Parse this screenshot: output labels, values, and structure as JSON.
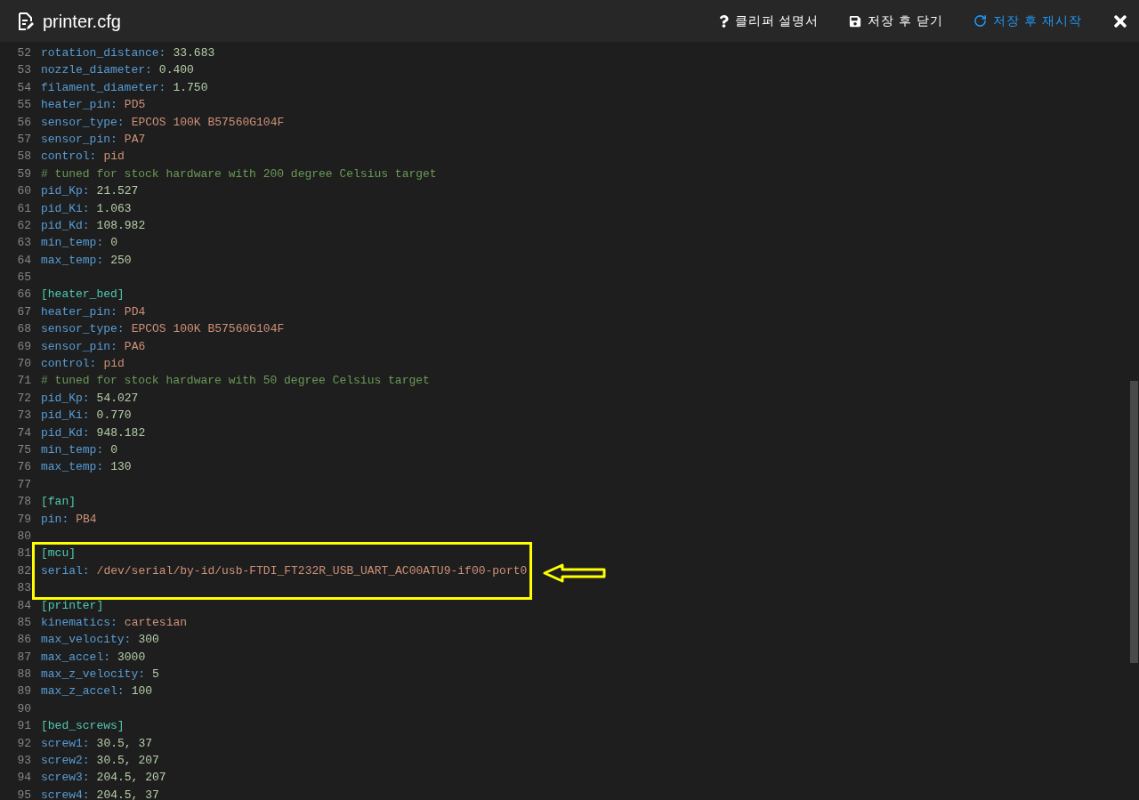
{
  "window": {
    "title": "printer.cfg"
  },
  "toolbar": [
    {
      "kind": "help",
      "label": "클리퍼 설명서"
    },
    {
      "kind": "save",
      "label": "저장 후 닫기"
    },
    {
      "kind": "restart",
      "label": "저장 후 재시작"
    }
  ],
  "lines": [
    {
      "number": "52",
      "kind": "pair",
      "key": "rotation_distance:",
      "value": {
        "text": "33.683",
        "kind": "number"
      },
      "highlighted": false
    },
    {
      "number": "53",
      "kind": "pair",
      "key": "nozzle_diameter:",
      "value": {
        "text": "0.400",
        "kind": "number"
      },
      "highlighted": false
    },
    {
      "number": "54",
      "kind": "pair",
      "key": "filament_diameter:",
      "value": {
        "text": "1.750",
        "kind": "number"
      },
      "highlighted": false
    },
    {
      "number": "55",
      "kind": "pair",
      "key": "heater_pin:",
      "value": {
        "text": "PD5",
        "kind": "string"
      },
      "highlighted": false
    },
    {
      "number": "56",
      "kind": "pair",
      "key": "sensor_type:",
      "value": {
        "text": "EPCOS 100K B57560G104F",
        "kind": "string"
      },
      "highlighted": false
    },
    {
      "number": "57",
      "kind": "pair",
      "key": "sensor_pin:",
      "value": {
        "text": "PA7",
        "kind": "string"
      },
      "highlighted": false
    },
    {
      "number": "58",
      "kind": "pair",
      "key": "control:",
      "value": {
        "text": "pid",
        "kind": "string"
      },
      "highlighted": false
    },
    {
      "number": "59",
      "kind": "comment",
      "text": "# tuned for stock hardware with 200 degree Celsius target",
      "highlighted": false
    },
    {
      "number": "60",
      "kind": "pair",
      "key": "pid_Kp:",
      "value": {
        "text": "21.527",
        "kind": "number"
      },
      "highlighted": false
    },
    {
      "number": "61",
      "kind": "pair",
      "key": "pid_Ki:",
      "value": {
        "text": "1.063",
        "kind": "number"
      },
      "highlighted": false
    },
    {
      "number": "62",
      "kind": "pair",
      "key": "pid_Kd:",
      "value": {
        "text": "108.982",
        "kind": "number"
      },
      "highlighted": false
    },
    {
      "number": "63",
      "kind": "pair",
      "key": "min_temp:",
      "value": {
        "text": "0",
        "kind": "number"
      },
      "highlighted": false
    },
    {
      "number": "64",
      "kind": "pair",
      "key": "max_temp:",
      "value": {
        "text": "250",
        "kind": "number"
      },
      "highlighted": false
    },
    {
      "number": "65",
      "kind": "blank",
      "highlighted": false
    },
    {
      "number": "66",
      "kind": "section",
      "text": "[heater_bed]",
      "highlighted": false
    },
    {
      "number": "67",
      "kind": "pair",
      "key": "heater_pin:",
      "value": {
        "text": "PD4",
        "kind": "string"
      },
      "highlighted": false
    },
    {
      "number": "68",
      "kind": "pair",
      "key": "sensor_type:",
      "value": {
        "text": "EPCOS 100K B57560G104F",
        "kind": "string"
      },
      "highlighted": false
    },
    {
      "number": "69",
      "kind": "pair",
      "key": "sensor_pin:",
      "value": {
        "text": "PA6",
        "kind": "string"
      },
      "highlighted": false
    },
    {
      "number": "70",
      "kind": "pair",
      "key": "control:",
      "value": {
        "text": "pid",
        "kind": "string"
      },
      "highlighted": false
    },
    {
      "number": "71",
      "kind": "comment",
      "text": "# tuned for stock hardware with 50 degree Celsius target",
      "highlighted": false
    },
    {
      "number": "72",
      "kind": "pair",
      "key": "pid_Kp:",
      "value": {
        "text": "54.027",
        "kind": "number"
      },
      "highlighted": false
    },
    {
      "number": "73",
      "kind": "pair",
      "key": "pid_Ki:",
      "value": {
        "text": "0.770",
        "kind": "number"
      },
      "highlighted": false
    },
    {
      "number": "74",
      "kind": "pair",
      "key": "pid_Kd:",
      "value": {
        "text": "948.182",
        "kind": "number"
      },
      "highlighted": false
    },
    {
      "number": "75",
      "kind": "pair",
      "key": "min_temp:",
      "value": {
        "text": "0",
        "kind": "number"
      },
      "highlighted": false
    },
    {
      "number": "76",
      "kind": "pair",
      "key": "max_temp:",
      "value": {
        "text": "130",
        "kind": "number"
      },
      "highlighted": false
    },
    {
      "number": "77",
      "kind": "blank",
      "highlighted": false
    },
    {
      "number": "78",
      "kind": "section",
      "text": "[fan]",
      "highlighted": false
    },
    {
      "number": "79",
      "kind": "pair",
      "key": "pin:",
      "value": {
        "text": "PB4",
        "kind": "string"
      },
      "highlighted": false
    },
    {
      "number": "80",
      "kind": "blank",
      "highlighted": false
    },
    {
      "number": "81",
      "kind": "section",
      "text": "[mcu]",
      "highlighted": true
    },
    {
      "number": "82",
      "kind": "pair",
      "key": "serial:",
      "value": {
        "text": "/dev/serial/by-id/usb-FTDI_FT232R_USB_UART_AC00ATU9-if00-port0",
        "kind": "string"
      },
      "highlighted": true
    },
    {
      "number": "83",
      "kind": "blank",
      "highlighted": true
    },
    {
      "number": "84",
      "kind": "section",
      "text": "[printer]",
      "highlighted": false
    },
    {
      "number": "85",
      "kind": "pair",
      "key": "kinematics:",
      "value": {
        "text": "cartesian",
        "kind": "string"
      },
      "highlighted": false
    },
    {
      "number": "86",
      "kind": "pair",
      "key": "max_velocity:",
      "value": {
        "text": "300",
        "kind": "number"
      },
      "highlighted": false
    },
    {
      "number": "87",
      "kind": "pair",
      "key": "max_accel:",
      "value": {
        "text": "3000",
        "kind": "number"
      },
      "highlighted": false
    },
    {
      "number": "88",
      "kind": "pair",
      "key": "max_z_velocity:",
      "value": {
        "text": "5",
        "kind": "number"
      },
      "highlighted": false
    },
    {
      "number": "89",
      "kind": "pair",
      "key": "max_z_accel:",
      "value": {
        "text": "100",
        "kind": "number"
      },
      "highlighted": false
    },
    {
      "number": "90",
      "kind": "blank",
      "highlighted": false
    },
    {
      "number": "91",
      "kind": "section",
      "text": "[bed_screws]",
      "highlighted": false
    },
    {
      "number": "92",
      "kind": "pair",
      "key": "screw1:",
      "value": {
        "text": "30.5, 37",
        "kind": "number"
      },
      "highlighted": false
    },
    {
      "number": "93",
      "kind": "pair",
      "key": "screw2:",
      "value": {
        "text": "30.5, 207",
        "kind": "number"
      },
      "highlighted": false
    },
    {
      "number": "94",
      "kind": "pair",
      "key": "screw3:",
      "value": {
        "text": "204.5, 207",
        "kind": "number"
      },
      "highlighted": false
    },
    {
      "number": "95",
      "kind": "pair",
      "key": "screw4:",
      "value": {
        "text": "204.5, 37",
        "kind": "number"
      },
      "highlighted": false
    }
  ]
}
